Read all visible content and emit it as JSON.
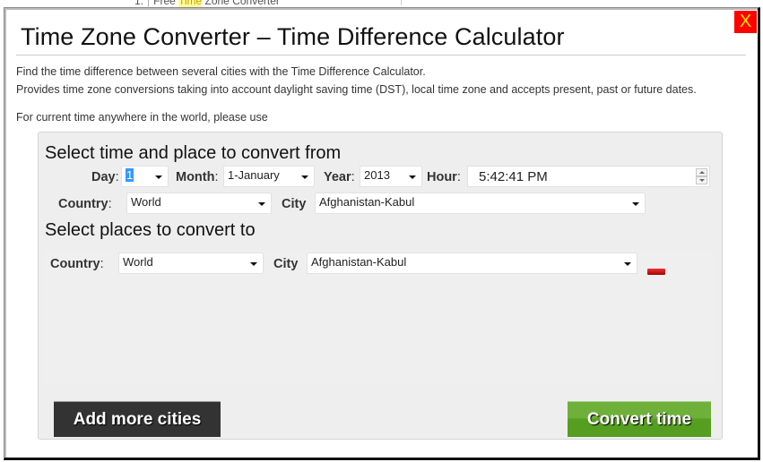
{
  "background": {
    "list_number": "1.",
    "link_prefix": "Free ",
    "link_highlight": "Time",
    "link_suffix": " Zone Converter"
  },
  "modal": {
    "close_label": "X",
    "title": "Time Zone Converter – Time Difference Calculator",
    "description": [
      "Find the time difference between several cities with the Time Difference Calculator.",
      "Provides time zone conversions taking into account daylight saving time (DST), local time zone and accepts present, past or future dates.",
      "For current time anywhere in the world, please use"
    ]
  },
  "from": {
    "heading": "Select time and place to convert from",
    "day_label": "Day",
    "day_value": "1",
    "month_label": "Month",
    "month_value": "1-January",
    "year_label": "Year",
    "year_value": "2013",
    "hour_label": "Hour",
    "hour_value": "5:42:41 PM",
    "country_label": "Country",
    "country_value": "World",
    "city_label": "City",
    "city_value": "Afghanistan-Kabul"
  },
  "to": {
    "heading": "Select places to convert to",
    "rows": [
      {
        "country_label": "Country",
        "country_value": "World",
        "city_label": "City",
        "city_value": "Afghanistan-Kabul"
      }
    ]
  },
  "actions": {
    "add_more_label": "Add more cities",
    "convert_label": "Convert time"
  },
  "colors": {
    "close_bg": "#ff0000",
    "close_fg": "#ffe600",
    "add_button_bg": "#333333",
    "convert_button_bg": "#5fa52a",
    "remove_button": "#cc1111"
  }
}
